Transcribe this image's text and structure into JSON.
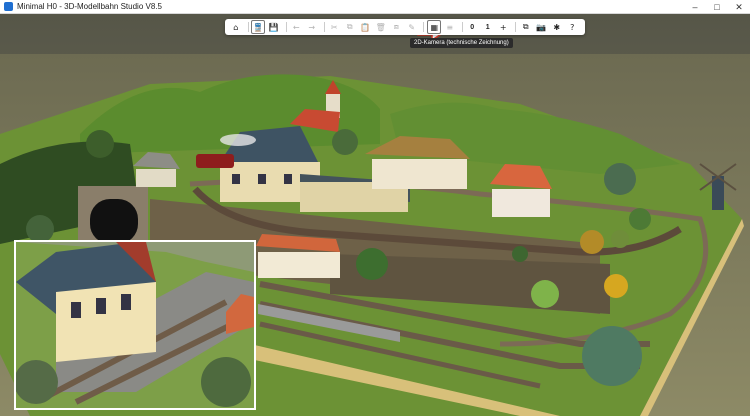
{
  "window": {
    "title": "Minimal H0 - 3D-Modellbahn Studio V8.5"
  },
  "toolbar": {
    "buttons": [
      {
        "name": "home-button",
        "icon": "home-icon",
        "glyph": "⌂",
        "enabled": true
      },
      {
        "name": "train-view-button",
        "icon": "train-icon",
        "glyph": "🚆",
        "enabled": true,
        "selected": true
      },
      {
        "name": "save-button",
        "icon": "floppy-icon",
        "glyph": "💾",
        "enabled": true
      },
      {
        "name": "undo-button",
        "icon": "arrow-left-icon",
        "glyph": "←",
        "enabled": false
      },
      {
        "name": "redo-button",
        "icon": "arrow-right-icon",
        "glyph": "→",
        "enabled": false
      },
      {
        "name": "cut-button",
        "icon": "scissors-icon",
        "glyph": "✂",
        "enabled": false
      },
      {
        "name": "copy-button",
        "icon": "copy-icon",
        "glyph": "⧉",
        "enabled": false
      },
      {
        "name": "paste-button",
        "icon": "clipboard-icon",
        "glyph": "📋",
        "enabled": false
      },
      {
        "name": "delete-button",
        "icon": "trash-icon",
        "glyph": "🗑",
        "enabled": false
      },
      {
        "name": "clone-button",
        "icon": "stack-icon",
        "glyph": "⧈",
        "enabled": false
      },
      {
        "name": "pipette-button",
        "icon": "pipette-icon",
        "glyph": "✎",
        "enabled": false
      },
      {
        "name": "camera-2d-button",
        "icon": "grid-icon",
        "glyph": "▦",
        "enabled": true,
        "selected": true
      },
      {
        "name": "layers-button",
        "icon": "layers-icon",
        "glyph": "≡",
        "enabled": false
      },
      {
        "name": "counter-a",
        "icon": "",
        "glyph": "0",
        "enabled": true,
        "num": true
      },
      {
        "name": "counter-b",
        "icon": "",
        "glyph": "1",
        "enabled": true,
        "num": true
      },
      {
        "name": "add-button",
        "icon": "plus-icon",
        "glyph": "+",
        "enabled": true
      },
      {
        "name": "window-button",
        "icon": "window-icon",
        "glyph": "⧉",
        "enabled": true
      },
      {
        "name": "screenshot-button",
        "icon": "camera-icon",
        "glyph": "📷",
        "enabled": true
      },
      {
        "name": "plugins-button",
        "icon": "puzzle-icon",
        "glyph": "✱",
        "enabled": true
      },
      {
        "name": "help-button",
        "icon": "question-icon",
        "glyph": "?",
        "enabled": true
      }
    ]
  },
  "tooltip": {
    "text": "2D-Kamera (technische Zeichnung)"
  },
  "colors": {
    "sky": "#5d5e4d",
    "ground": "#8a8661",
    "grass": "#6e9a3a",
    "board_edge": "#d8c07a",
    "arrow": "#e23b2b"
  }
}
